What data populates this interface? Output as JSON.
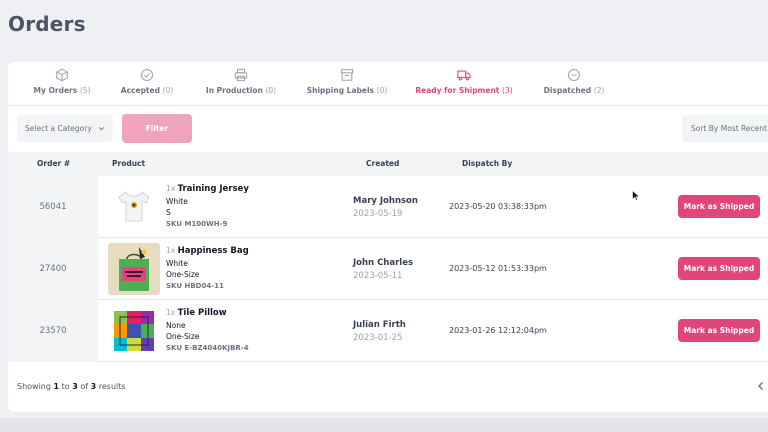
{
  "page": {
    "title": "Orders"
  },
  "tabs": [
    {
      "label": "My Orders",
      "count": "(5)",
      "icon": "box-icon"
    },
    {
      "label": "Accepted",
      "count": "(0)",
      "icon": "check-circle-icon"
    },
    {
      "label": "In Production",
      "count": "(0)",
      "icon": "printer-icon"
    },
    {
      "label": "Shipping Labels",
      "count": "(0)",
      "icon": "archive-icon"
    },
    {
      "label": "Ready for Shipment",
      "count": "(3)",
      "icon": "truck-icon",
      "active": true
    },
    {
      "label": "Dispatched",
      "count": "(2)",
      "icon": "dash-circle-icon"
    }
  ],
  "filters": {
    "category_placeholder": "Select a Category",
    "filter_label": "Filter",
    "sort_label": "Sort By Most Recent"
  },
  "table": {
    "headers": {
      "order": "Order #",
      "product": "Product",
      "created": "Created",
      "dispatch": "Dispatch By"
    },
    "rows": [
      {
        "order_id": "56041",
        "qty": "1x",
        "product": "Training Jersey",
        "color": "White",
        "size": "S",
        "sku": "SKU M100WH-9",
        "customer": "Mary Johnson",
        "created": "2023-05-19",
        "dispatch_by": "2023-05-20 03:38:33pm",
        "action": "Mark as Shipped"
      },
      {
        "order_id": "27400",
        "qty": "1x",
        "product": "Happiness Bag",
        "color": "White",
        "size": "One-Size",
        "sku": "SKU HBD04-11",
        "customer": "John Charles",
        "created": "2023-05-11",
        "dispatch_by": "2023-05-12 01:53:33pm",
        "action": "Mark as Shipped"
      },
      {
        "order_id": "23570",
        "qty": "1x",
        "product": "Tile Pillow",
        "color": "None",
        "size": "One-Size",
        "sku": "SKU E-BZ4040KJBR-4",
        "customer": "Julian Firth",
        "created": "2023-01-25",
        "dispatch_by": "2023-01-26 12:12:04pm",
        "action": "Mark as Shipped"
      }
    ]
  },
  "footer": {
    "prefix": "Showing",
    "from": "1",
    "to_word": "to",
    "to": "3",
    "of_word": "of",
    "total": "3",
    "suffix": "results"
  },
  "colors": {
    "accent": "#e0457b",
    "accent_light": "#f0a3bf",
    "background": "#eef0f4"
  }
}
